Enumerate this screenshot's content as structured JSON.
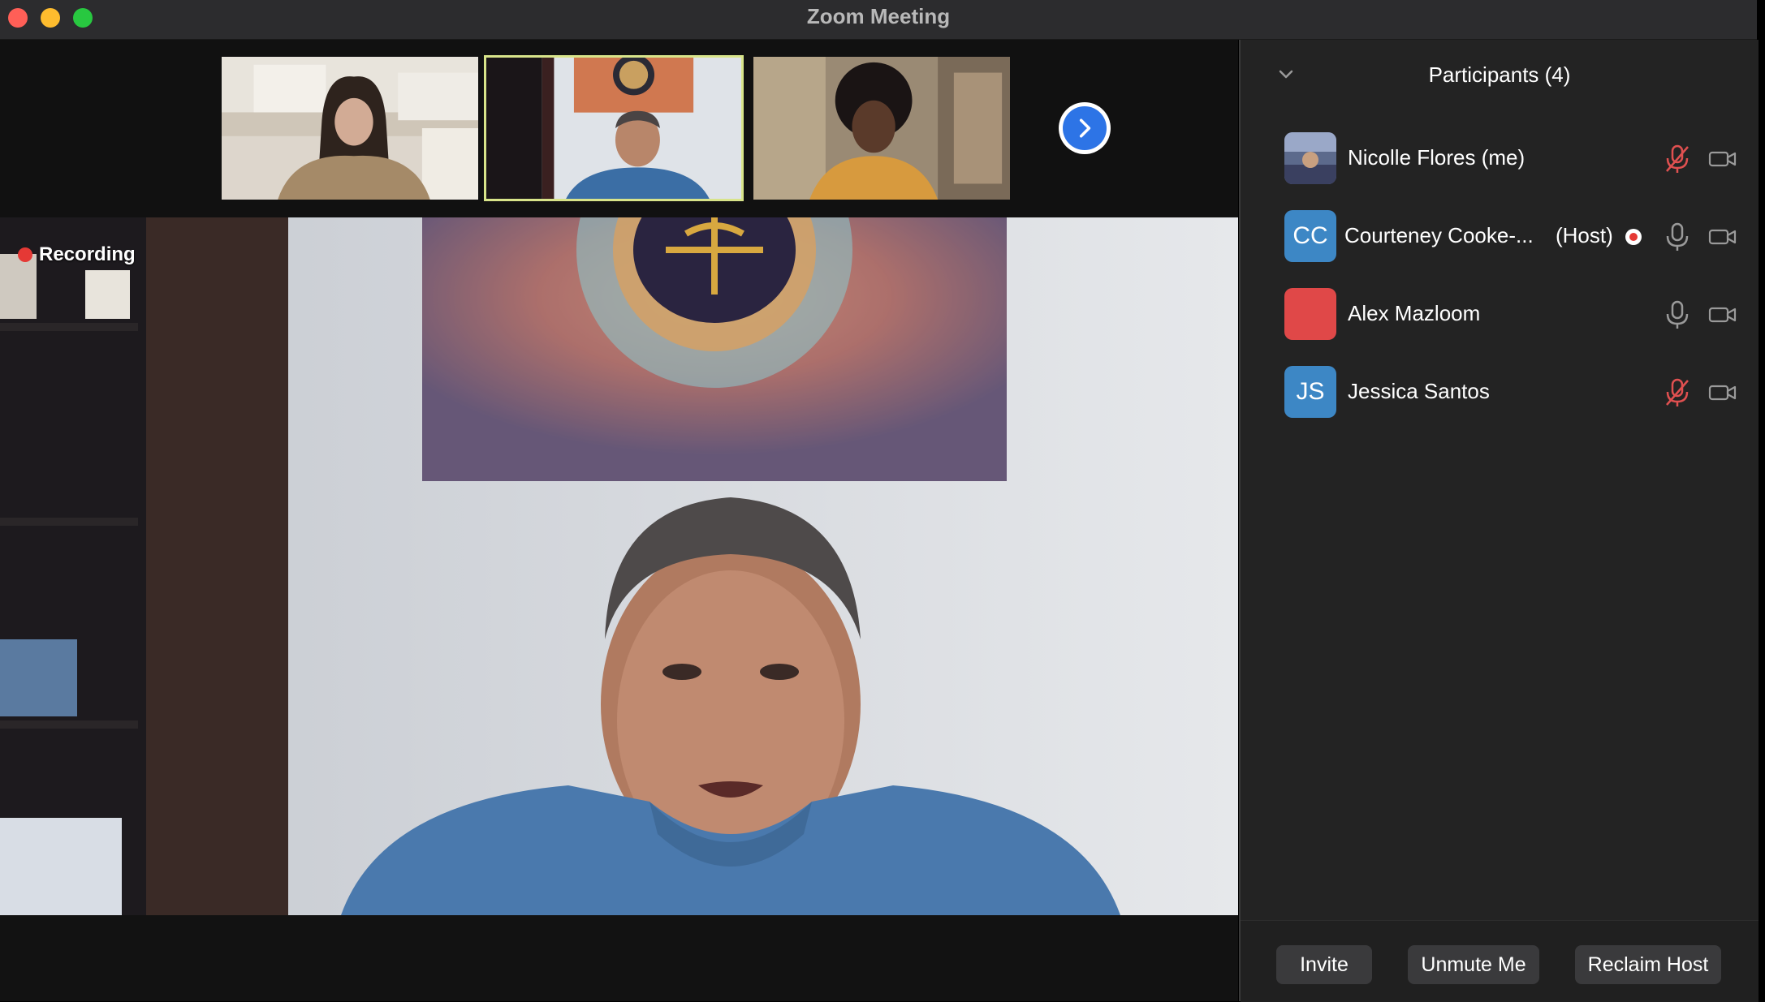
{
  "window": {
    "title": "Zoom Meeting"
  },
  "video": {
    "recording_label": "Recording",
    "next_page_icon": "chevron-right-icon"
  },
  "participants_panel": {
    "title": "Participants (4)",
    "participants": [
      {
        "name": "Nicolle Flores (me)",
        "initials": "",
        "avatar": "photo",
        "mic": "muted",
        "video": "off"
      },
      {
        "name": "Courteney Cooke-...",
        "initials": "CC",
        "avatar": "blue",
        "role": "(Host)",
        "recording": true,
        "mic": "on",
        "video": "off"
      },
      {
        "name": "Alex Mazloom",
        "initials": "",
        "avatar": "red",
        "mic": "on",
        "video": "off"
      },
      {
        "name": "Jessica Santos",
        "initials": "JS",
        "avatar": "blue",
        "mic": "muted",
        "video": "off"
      }
    ],
    "buttons": {
      "invite": "Invite",
      "unmute": "Unmute Me",
      "reclaim_host": "Reclaim Host"
    }
  },
  "colors": {
    "accent_blue": "#2d74e6",
    "recording_red": "#e53935",
    "active_speaker_border": "#d8e48a",
    "muted_red": "#e05050"
  }
}
